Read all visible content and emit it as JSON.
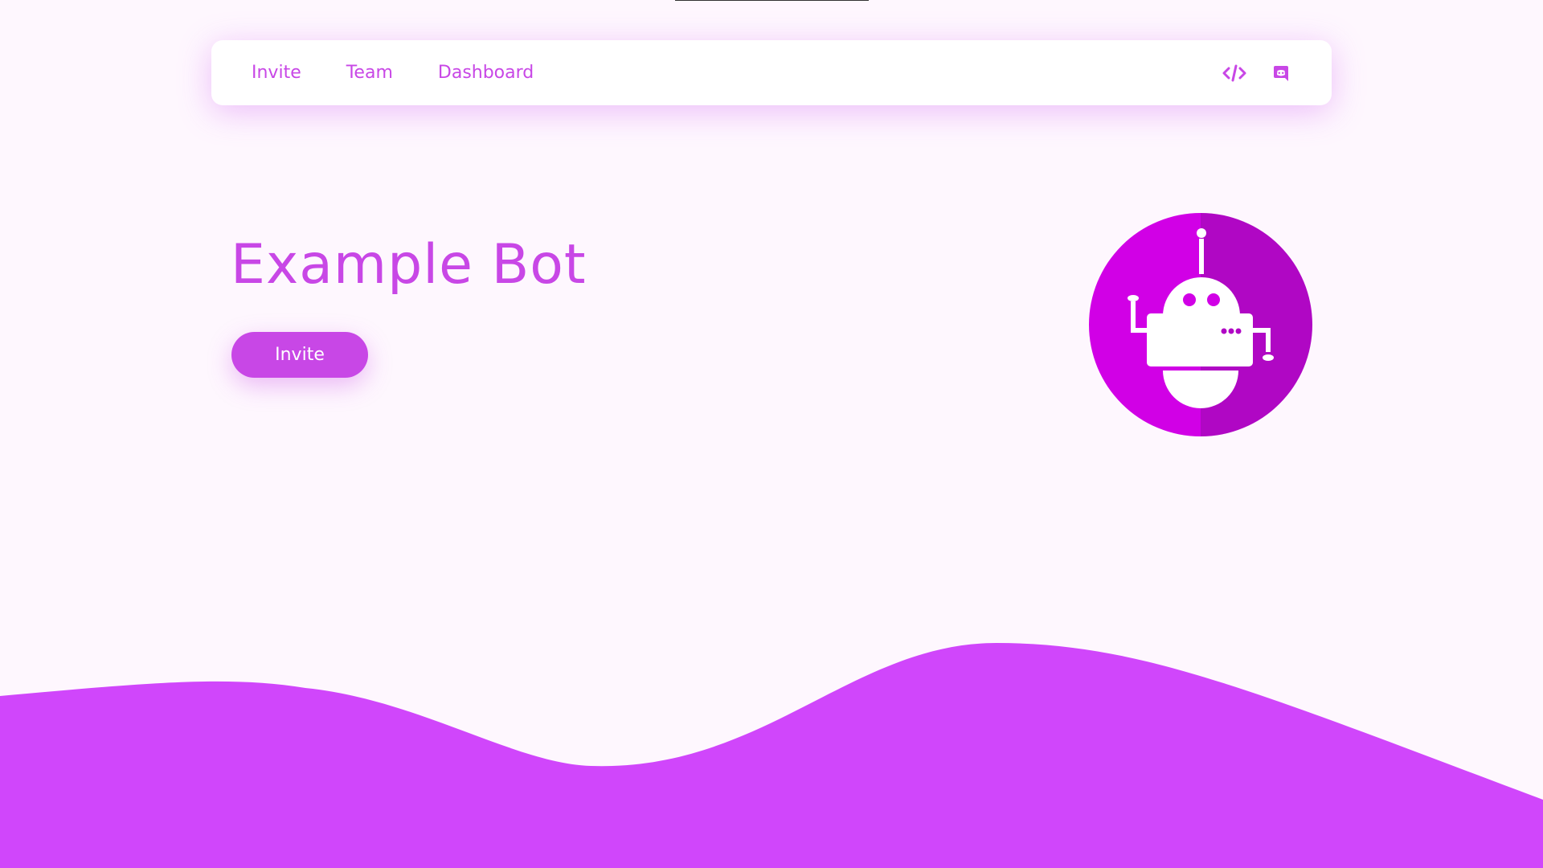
{
  "nav": {
    "links": [
      {
        "label": "Invite"
      },
      {
        "label": "Team"
      },
      {
        "label": "Dashboard"
      }
    ],
    "icons": [
      "code-icon",
      "discord-icon"
    ]
  },
  "hero": {
    "title": "Example Bot",
    "button_label": "Invite"
  },
  "colors": {
    "accent": "#c847e6",
    "wave": "#d046fb",
    "background": "#fef7fe",
    "logo_light": "#d100e6",
    "logo_dark": "#b007c4"
  }
}
